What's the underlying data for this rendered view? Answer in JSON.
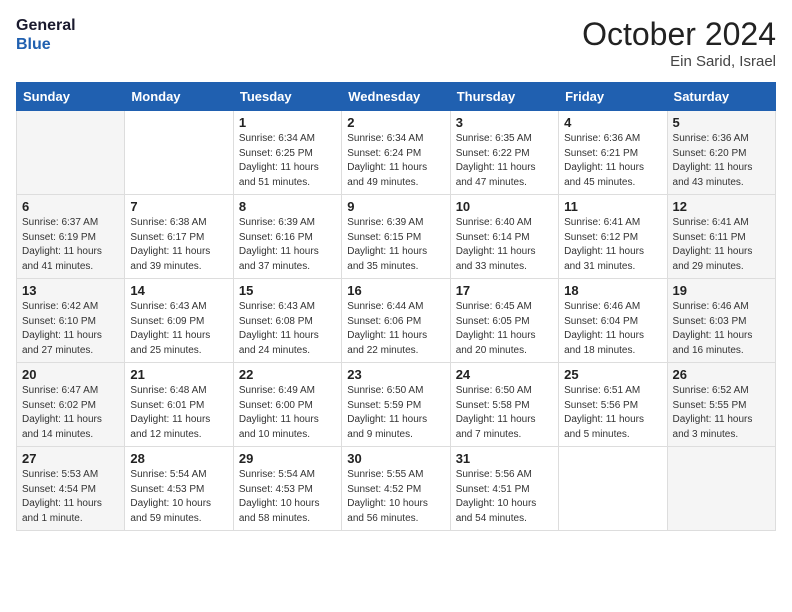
{
  "header": {
    "logo_line1": "General",
    "logo_line2": "Blue",
    "month": "October 2024",
    "location": "Ein Sarid, Israel"
  },
  "days_of_week": [
    "Sunday",
    "Monday",
    "Tuesday",
    "Wednesday",
    "Thursday",
    "Friday",
    "Saturday"
  ],
  "weeks": [
    [
      {
        "day": "",
        "info": ""
      },
      {
        "day": "",
        "info": ""
      },
      {
        "day": "1",
        "info": "Sunrise: 6:34 AM\nSunset: 6:25 PM\nDaylight: 11 hours and 51 minutes."
      },
      {
        "day": "2",
        "info": "Sunrise: 6:34 AM\nSunset: 6:24 PM\nDaylight: 11 hours and 49 minutes."
      },
      {
        "day": "3",
        "info": "Sunrise: 6:35 AM\nSunset: 6:22 PM\nDaylight: 11 hours and 47 minutes."
      },
      {
        "day": "4",
        "info": "Sunrise: 6:36 AM\nSunset: 6:21 PM\nDaylight: 11 hours and 45 minutes."
      },
      {
        "day": "5",
        "info": "Sunrise: 6:36 AM\nSunset: 6:20 PM\nDaylight: 11 hours and 43 minutes."
      }
    ],
    [
      {
        "day": "6",
        "info": "Sunrise: 6:37 AM\nSunset: 6:19 PM\nDaylight: 11 hours and 41 minutes."
      },
      {
        "day": "7",
        "info": "Sunrise: 6:38 AM\nSunset: 6:17 PM\nDaylight: 11 hours and 39 minutes."
      },
      {
        "day": "8",
        "info": "Sunrise: 6:39 AM\nSunset: 6:16 PM\nDaylight: 11 hours and 37 minutes."
      },
      {
        "day": "9",
        "info": "Sunrise: 6:39 AM\nSunset: 6:15 PM\nDaylight: 11 hours and 35 minutes."
      },
      {
        "day": "10",
        "info": "Sunrise: 6:40 AM\nSunset: 6:14 PM\nDaylight: 11 hours and 33 minutes."
      },
      {
        "day": "11",
        "info": "Sunrise: 6:41 AM\nSunset: 6:12 PM\nDaylight: 11 hours and 31 minutes."
      },
      {
        "day": "12",
        "info": "Sunrise: 6:41 AM\nSunset: 6:11 PM\nDaylight: 11 hours and 29 minutes."
      }
    ],
    [
      {
        "day": "13",
        "info": "Sunrise: 6:42 AM\nSunset: 6:10 PM\nDaylight: 11 hours and 27 minutes."
      },
      {
        "day": "14",
        "info": "Sunrise: 6:43 AM\nSunset: 6:09 PM\nDaylight: 11 hours and 25 minutes."
      },
      {
        "day": "15",
        "info": "Sunrise: 6:43 AM\nSunset: 6:08 PM\nDaylight: 11 hours and 24 minutes."
      },
      {
        "day": "16",
        "info": "Sunrise: 6:44 AM\nSunset: 6:06 PM\nDaylight: 11 hours and 22 minutes."
      },
      {
        "day": "17",
        "info": "Sunrise: 6:45 AM\nSunset: 6:05 PM\nDaylight: 11 hours and 20 minutes."
      },
      {
        "day": "18",
        "info": "Sunrise: 6:46 AM\nSunset: 6:04 PM\nDaylight: 11 hours and 18 minutes."
      },
      {
        "day": "19",
        "info": "Sunrise: 6:46 AM\nSunset: 6:03 PM\nDaylight: 11 hours and 16 minutes."
      }
    ],
    [
      {
        "day": "20",
        "info": "Sunrise: 6:47 AM\nSunset: 6:02 PM\nDaylight: 11 hours and 14 minutes."
      },
      {
        "day": "21",
        "info": "Sunrise: 6:48 AM\nSunset: 6:01 PM\nDaylight: 11 hours and 12 minutes."
      },
      {
        "day": "22",
        "info": "Sunrise: 6:49 AM\nSunset: 6:00 PM\nDaylight: 11 hours and 10 minutes."
      },
      {
        "day": "23",
        "info": "Sunrise: 6:50 AM\nSunset: 5:59 PM\nDaylight: 11 hours and 9 minutes."
      },
      {
        "day": "24",
        "info": "Sunrise: 6:50 AM\nSunset: 5:58 PM\nDaylight: 11 hours and 7 minutes."
      },
      {
        "day": "25",
        "info": "Sunrise: 6:51 AM\nSunset: 5:56 PM\nDaylight: 11 hours and 5 minutes."
      },
      {
        "day": "26",
        "info": "Sunrise: 6:52 AM\nSunset: 5:55 PM\nDaylight: 11 hours and 3 minutes."
      }
    ],
    [
      {
        "day": "27",
        "info": "Sunrise: 5:53 AM\nSunset: 4:54 PM\nDaylight: 11 hours and 1 minute."
      },
      {
        "day": "28",
        "info": "Sunrise: 5:54 AM\nSunset: 4:53 PM\nDaylight: 10 hours and 59 minutes."
      },
      {
        "day": "29",
        "info": "Sunrise: 5:54 AM\nSunset: 4:53 PM\nDaylight: 10 hours and 58 minutes."
      },
      {
        "day": "30",
        "info": "Sunrise: 5:55 AM\nSunset: 4:52 PM\nDaylight: 10 hours and 56 minutes."
      },
      {
        "day": "31",
        "info": "Sunrise: 5:56 AM\nSunset: 4:51 PM\nDaylight: 10 hours and 54 minutes."
      },
      {
        "day": "",
        "info": ""
      },
      {
        "day": "",
        "info": ""
      }
    ]
  ]
}
